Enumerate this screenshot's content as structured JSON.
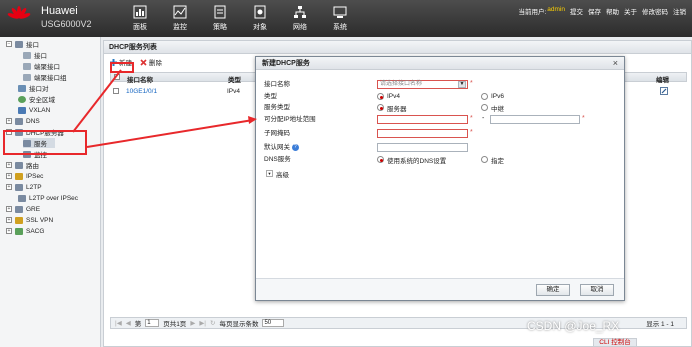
{
  "header": {
    "brand": "Huawei",
    "model": "USG6000V2",
    "nav": [
      {
        "label": "面板",
        "icon": "dashboard-icon"
      },
      {
        "label": "监控",
        "icon": "monitor-icon"
      },
      {
        "label": "策略",
        "icon": "policy-icon"
      },
      {
        "label": "对象",
        "icon": "object-icon"
      },
      {
        "label": "网络",
        "icon": "network-icon"
      },
      {
        "label": "系统",
        "icon": "system-icon"
      }
    ],
    "user_prefix": "当前用户:",
    "username": "admin",
    "links": [
      "提交",
      "保存",
      "帮助",
      "关于",
      "修改密码",
      "注销"
    ]
  },
  "sidebar": {
    "items": [
      {
        "label": "接口"
      },
      {
        "label": "接口"
      },
      {
        "label": "端聚接口"
      },
      {
        "label": "端聚接口组"
      },
      {
        "label": "接口对"
      },
      {
        "label": "安全区域"
      },
      {
        "label": "VXLAN"
      },
      {
        "label": "DNS"
      },
      {
        "label": "DHCP服务器"
      },
      {
        "label": "服务"
      },
      {
        "label": "监控"
      },
      {
        "label": "路由"
      },
      {
        "label": "IPSec"
      },
      {
        "label": "L2TP"
      },
      {
        "label": "L2TP over IPSec"
      },
      {
        "label": "GRE"
      },
      {
        "label": "SSL VPN"
      },
      {
        "label": "SACG"
      }
    ]
  },
  "main": {
    "title": "DHCP服务列表",
    "toolbar": {
      "new": "新建",
      "delete": "删除"
    },
    "columns": {
      "iface": "接口名称",
      "type": "类型",
      "edit": "编辑"
    },
    "rows": [
      {
        "iface": "10GE1/0/1",
        "type": "IPv4"
      }
    ],
    "pager": {
      "page_prefix": "第",
      "page": "1",
      "page_suffix": "页共1页",
      "per_page_label": "每页显示条数",
      "per_page": "50",
      "summary": "显示 1 - 1"
    }
  },
  "dialog": {
    "title": "新建DHCP服务",
    "labels": {
      "iface": "接口名称",
      "type": "类型",
      "service_type": "服务类型",
      "range": "可分配IP地址范围",
      "mask": "子网掩码",
      "gateway": "默认网关",
      "dns": "DNS服务"
    },
    "iface_placeholder": "请选择接口名称",
    "type_options": {
      "ipv4": "IPv4",
      "ipv6": "IPv6"
    },
    "service_options": {
      "server": "服务器",
      "relay": "中继"
    },
    "range_sep": "-",
    "dns_options": {
      "system": "使用系统的DNS设置",
      "custom": "指定"
    },
    "advanced": "高级",
    "ok": "确定",
    "cancel": "取消"
  },
  "cli": "CLI 控制台",
  "watermark": "CSDN @Joe_RX",
  "colors": {
    "accent_red": "#e8282b",
    "link_blue": "#1565c0",
    "topbar": "#3a3a3a"
  }
}
